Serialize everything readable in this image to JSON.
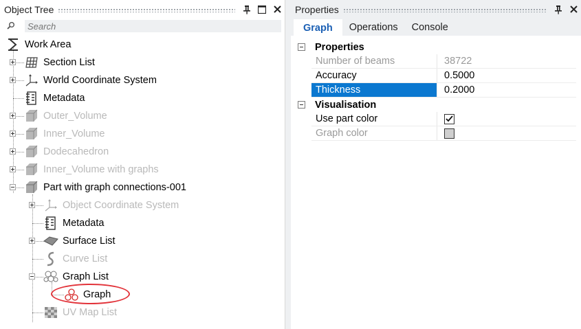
{
  "object_tree": {
    "title": "Object Tree",
    "search_placeholder": "Search",
    "nodes": [
      {
        "label": "Work Area"
      },
      {
        "label": "Section List"
      },
      {
        "label": "World Coordinate System"
      },
      {
        "label": "Metadata"
      },
      {
        "label": "Outer_Volume"
      },
      {
        "label": "Inner_Volume"
      },
      {
        "label": "Dodecahedron"
      },
      {
        "label": "Inner_Volume with graphs"
      },
      {
        "label": "Part with graph connections-001"
      },
      {
        "label": "Object Coordinate System"
      },
      {
        "label": "Metadata"
      },
      {
        "label": "Surface List"
      },
      {
        "label": "Curve List"
      },
      {
        "label": "Graph List"
      },
      {
        "label": "Graph"
      },
      {
        "label": "UV Map List"
      }
    ]
  },
  "properties": {
    "title": "Properties",
    "tabs": [
      {
        "label": "Graph"
      },
      {
        "label": "Operations"
      },
      {
        "label": "Console"
      }
    ],
    "categories": [
      {
        "name": "Properties",
        "rows": [
          {
            "name": "Number of beams",
            "value": "38722"
          },
          {
            "name": "Accuracy",
            "value": "0.5000"
          },
          {
            "name": "Thickness",
            "value": "0.2000"
          }
        ]
      },
      {
        "name": "Visualisation",
        "rows": [
          {
            "name": "Use part color",
            "value": "checked"
          },
          {
            "name": "Graph color",
            "value": "#cfcfcf"
          }
        ]
      }
    ]
  },
  "colors": {
    "accent": "#1a5fb4",
    "selection": "#0b78d0",
    "highlight_ring": "#e2333a"
  }
}
